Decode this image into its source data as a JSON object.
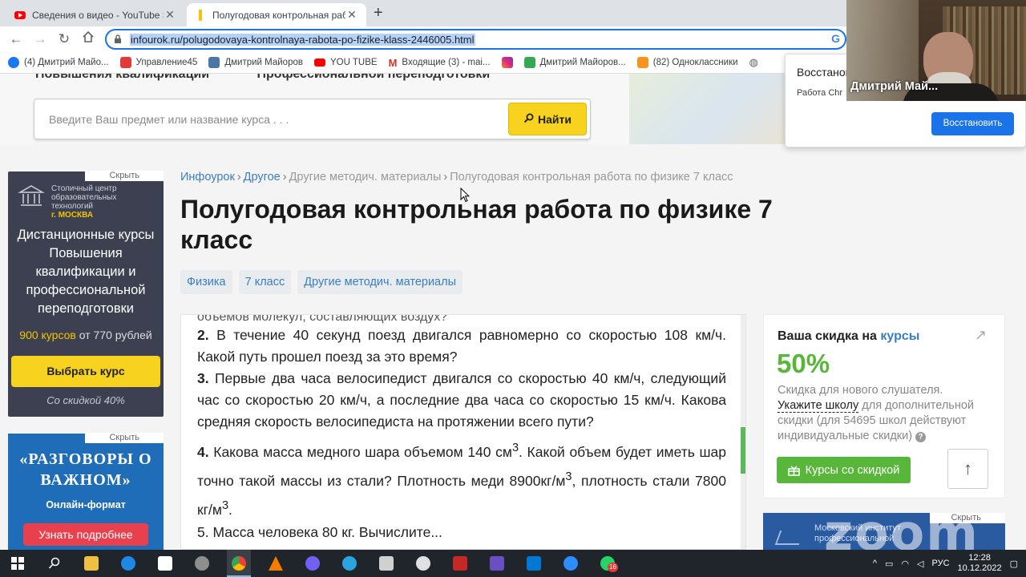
{
  "browser": {
    "tabs": [
      {
        "title": "Сведения о видео - YouTube St",
        "active": false
      },
      {
        "title": "Полугодовая контрольная раб",
        "active": true
      }
    ],
    "new_tab": "+",
    "close_glyph": "✕",
    "url": "infourok.ru/polugodovaya-kontrolnaya-rabota-po-fizike-klass-2446005.html",
    "g_icon": "G",
    "bookmarks": [
      {
        "label": "(4) Дмитрий Майо...",
        "icon_color": "#1877f2"
      },
      {
        "label": "Управление45",
        "icon_color": "#e53935"
      },
      {
        "label": "Дмитрий Майоров",
        "icon_color": "#4a76a8"
      },
      {
        "label": "YOU TUBE",
        "icon_color": "#ff0000"
      },
      {
        "label": "Входящие (3) - mai...",
        "icon_color": "#d93025"
      },
      {
        "label": "",
        "icon_color": "#c13584"
      },
      {
        "label": "Дмитрий Майоров...",
        "icon_color": "#34a853"
      },
      {
        "label": "(82) Одноклассники",
        "icon_color": "#f7931e"
      }
    ]
  },
  "restore_popup": {
    "title": "Восстанов",
    "text": "Работа Chr",
    "button": "Восстановить"
  },
  "webcam": {
    "name": "Дмитрий Май..."
  },
  "site": {
    "hero_clipped": [
      "Повышения квалификации",
      "Профессиональной переподготовки"
    ],
    "search_placeholder": "Введите Ваш предмет или название курса . . .",
    "search_button": "Найти",
    "breadcrumbs": [
      "Инфоурок",
      "Другое",
      "Другие методич. материалы",
      "Полугодовая контрольная работа по физике 7 класс"
    ],
    "title": "Полугодовая контрольная работа по физике 7 класс",
    "tags": [
      "Физика",
      "7 класс",
      "Другие методич. материалы"
    ],
    "doc": {
      "cut_line": "объемов молекул, составляющих воздух?",
      "q2_num": "2.",
      "q2": "В течение 40 секунд поезд двигался равномерно со скоростью 108 км/ч. Какой путь прошел поезд за это время?",
      "q3_num": "3.",
      "q3": "Первые два часа велосипедист двигался со скоростью 40 км/ч, следующий час со скоростью 20 км/ч, а последние два часа со скоростью 15 км/ч. Какова средняя скорость велосипедиста на протяжении всего пути?",
      "q4_num": "4.",
      "q4_a": "Какова масса медного шара объемом 140 см",
      "q4_b": ". Какой объем будет иметь шар точно такой массы из стали? Плотность меди 8900кг/м",
      "q4_c": ", плотность стали 7800 кг/м",
      "q4_d": ".",
      "sup3": "3",
      "cut_bottom": "5. Масса человека 80 кг. Вычислите..."
    }
  },
  "left_ads": {
    "hide_label": "Скрыть",
    "ad1": {
      "logo_text": "Столичный центр образовательных технологий",
      "logo_city": "г. МОСКВА",
      "title": "Дистанционные курсы Повышения квалификации и профессиональной переподготовки",
      "price_courses": "900 курсов",
      "price_rest": " от 770 рублей",
      "button": "Выбрать курс",
      "discount": "Со скидкой 40%"
    },
    "ad2": {
      "title": "«РАЗГОВОРЫ О ВАЖНОМ»",
      "sub": "Онлайн-формат",
      "button": "Узнать подробнее"
    }
  },
  "discount_panel": {
    "heading": "Ваша скидка на ",
    "heading_link": "курсы",
    "arrow": "↗",
    "percent": "50%",
    "line1": "Скидка для нового слушателя.",
    "link": "Укажите школу",
    "line2": " для дополнительной скидки (для 54695 школ действуют индивидуальные скидки)",
    "qmark": "?",
    "button": "Курсы со скидкой"
  },
  "right_ad": {
    "hide_label": "Скрыть",
    "text": "Московский институт профессиональной"
  },
  "zoom_watermark": "zoom",
  "scroll_up": "↑",
  "taskbar": {
    "tray_lang": "РУС",
    "time": "12:28",
    "date": "10.12.2022",
    "whatsapp_badge": "16",
    "tray_arrow": "^"
  }
}
